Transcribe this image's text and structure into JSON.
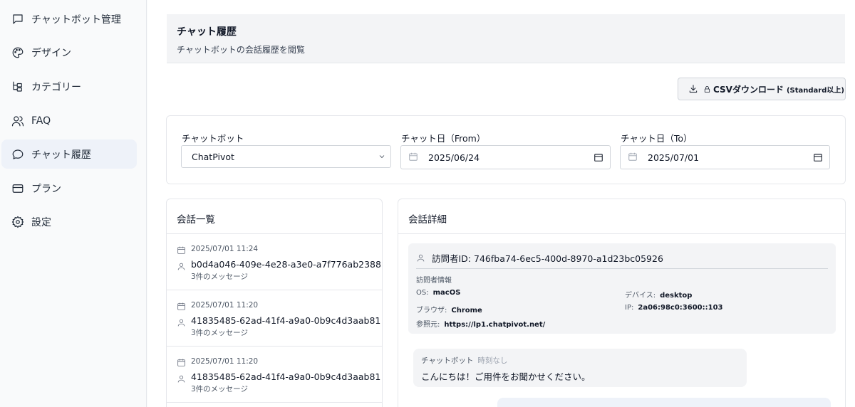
{
  "sidebar": {
    "items": [
      {
        "label": "チャットボット管理",
        "icon": "chat-square-icon",
        "active": false
      },
      {
        "label": "デザイン",
        "icon": "palette-icon",
        "active": false
      },
      {
        "label": "カテゴリー",
        "icon": "folder-tree-icon",
        "active": false
      },
      {
        "label": "FAQ",
        "icon": "users-icon",
        "active": false
      },
      {
        "label": "チャット履歴",
        "icon": "chat-bubble-icon",
        "active": true
      },
      {
        "label": "プラン",
        "icon": "credit-card-icon",
        "active": false
      },
      {
        "label": "設定",
        "icon": "gear-icon",
        "active": false
      }
    ]
  },
  "header": {
    "title": "チャット履歴",
    "subtitle": "チャットボットの会話履歴を閲覧"
  },
  "toolbar": {
    "csv_label": "CSVダウンロード",
    "csv_note": "(Standard以上)"
  },
  "filters": {
    "chatbot_label": "チャットボット",
    "chatbot_value": "ChatPivot",
    "from_label": "チャット日（From）",
    "from_value": "2025/06/24",
    "to_label": "チャット日（To）",
    "to_value": "2025/07/01"
  },
  "conversations": {
    "title": "会話一覧",
    "items": [
      {
        "date": "2025/07/01 11:24",
        "id": "b0d4a046-409e-4e28-a3e0-a7f776ab2388",
        "count": "3件のメッセージ"
      },
      {
        "date": "2025/07/01 11:20",
        "id": "41835485-62ad-41f4-a9a0-0b9c4d3aab81",
        "count": "3件のメッセージ"
      },
      {
        "date": "2025/07/01 11:20",
        "id": "41835485-62ad-41f4-a9a0-0b9c4d3aab81",
        "count": "3件のメッセージ"
      }
    ]
  },
  "detail": {
    "title": "会話詳細",
    "visitor_id": "訪問者ID: 746fba74-6ec5-400d-8970-a1d23bc05926",
    "info_title": "訪問者情報",
    "os_label": "OS:",
    "os_value": "macOS",
    "device_label": "デバイス:",
    "device_value": "desktop",
    "browser_label": "ブラウザ:",
    "browser_value": "Chrome",
    "ip_label": "IP:",
    "ip_value": "2a06:98c0:3600::103",
    "ref_label": "参照元:",
    "ref_value": "https://lp1.chatpivot.net/",
    "messages": [
      {
        "sender": "チャットボット",
        "time": "時刻なし",
        "text": "こんにちは！ご用件をお聞かせください。"
      }
    ]
  }
}
